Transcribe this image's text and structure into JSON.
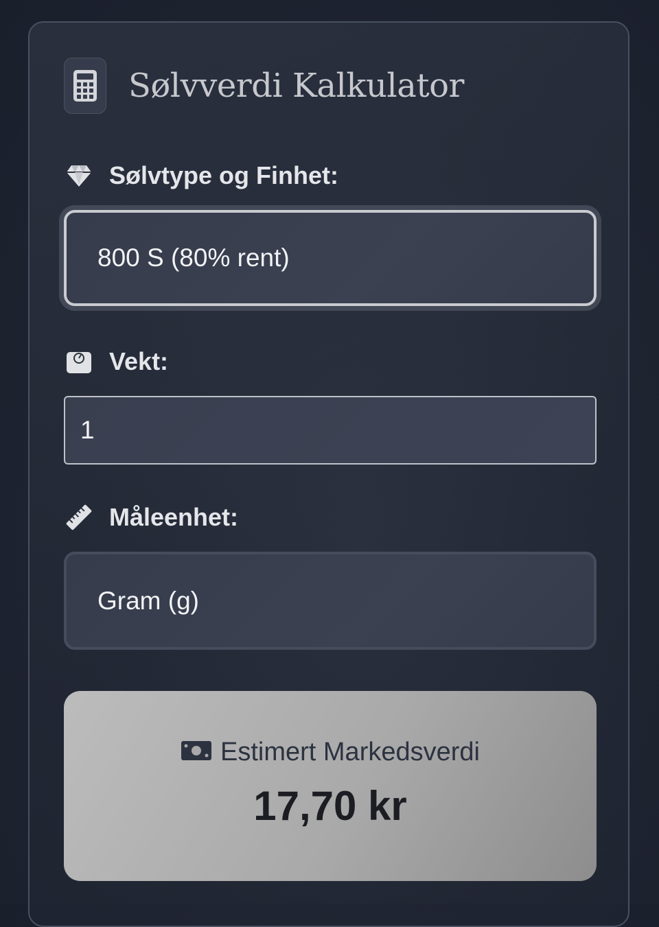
{
  "header": {
    "title": "Sølvverdi Kalkulator",
    "icon": "calculator-icon"
  },
  "silver_type": {
    "label": "Sølvtype og Finhet:",
    "icon": "gem-icon",
    "selected": "800 S (80% rent)"
  },
  "weight": {
    "label": "Vekt:",
    "icon": "scale-icon",
    "value": "1"
  },
  "unit": {
    "label": "Måleenhet:",
    "icon": "ruler-icon",
    "selected": "Gram (g)"
  },
  "result": {
    "label": "Estimert Markedsverdi",
    "icon": "money-bill-icon",
    "value": "17,70 kr"
  },
  "colors": {
    "background": "#1f2431",
    "text_light": "#e4e6ea",
    "result_bg": "#a9a9a9"
  }
}
